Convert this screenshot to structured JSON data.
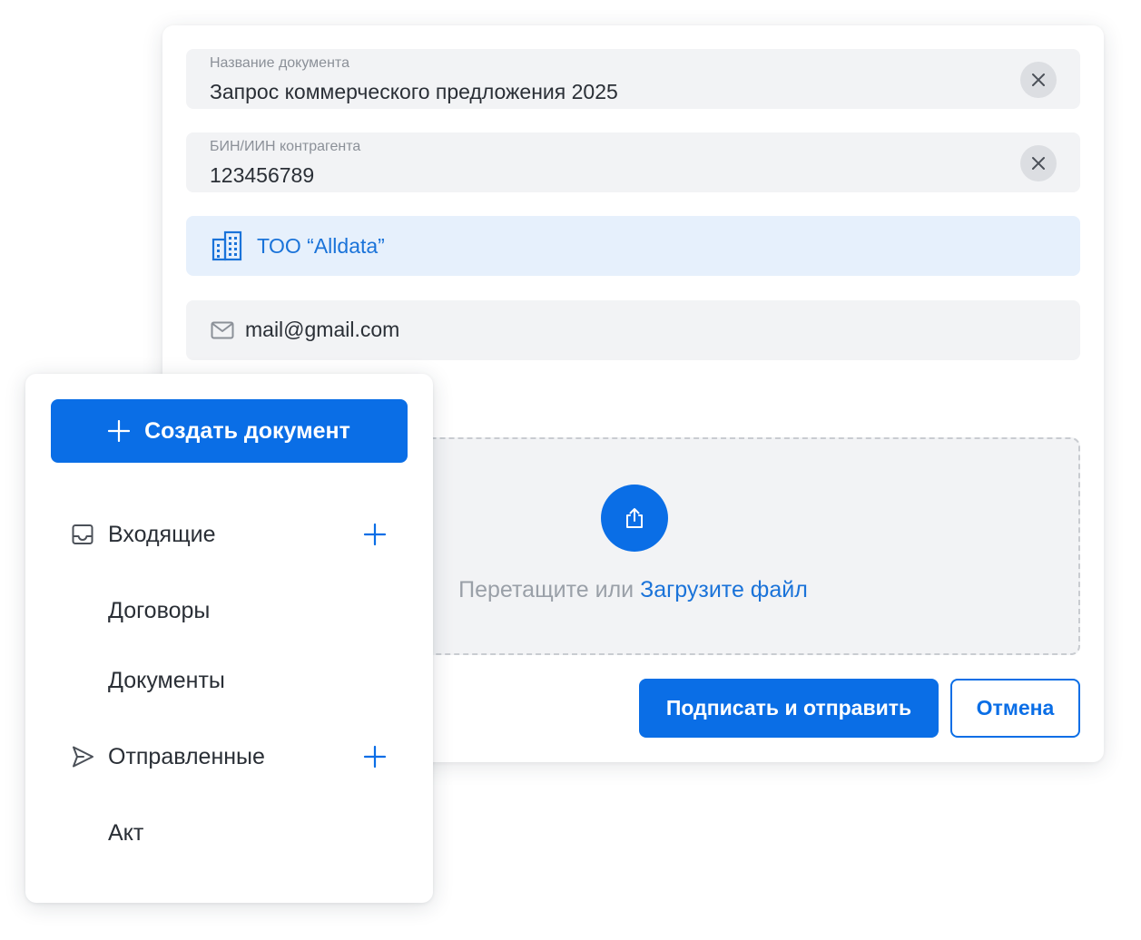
{
  "form": {
    "doc_name": {
      "label": "Название документа",
      "value": "Запрос коммерческого предложения 2025"
    },
    "bin": {
      "label": "БИН/ИИН контрагента",
      "value": "123456789"
    },
    "company": {
      "name": "ТОО “Alldata”",
      "icon": "building-icon"
    },
    "email": {
      "value": "mail@gmail.com",
      "icon": "mail-icon"
    },
    "upload": {
      "icon": "upload-icon",
      "text": "Перетащите или",
      "link": "Загрузите файл"
    },
    "actions": {
      "submit_label": "Подписать и отправить",
      "cancel_label": "Отмена"
    }
  },
  "sidebar": {
    "create_label": "Создать документ",
    "items": [
      {
        "label": "Входящие",
        "icon": "inbox-icon",
        "has_add": true
      },
      {
        "label": "Договоры",
        "icon": "",
        "has_add": false
      },
      {
        "label": "Документы",
        "icon": "",
        "has_add": false
      },
      {
        "label": "Отправленные",
        "icon": "send-icon",
        "has_add": true
      },
      {
        "label": "Акт",
        "icon": "",
        "has_add": false
      }
    ]
  },
  "colors": {
    "accent": "#0a6ee6",
    "company_bg": "#e6f0fc",
    "field_bg": "#f2f3f5"
  }
}
